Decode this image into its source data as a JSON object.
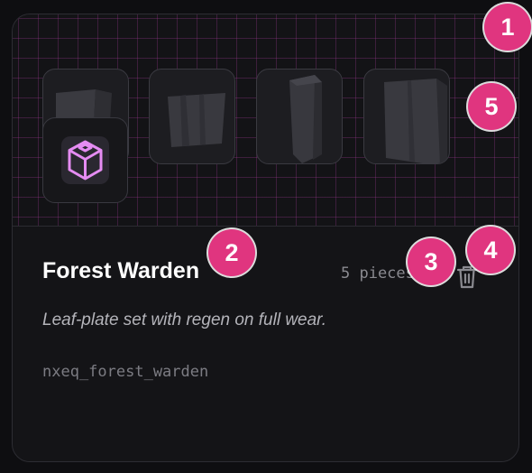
{
  "card": {
    "title": "Forest Warden",
    "pieces": "5 pieces",
    "description": "Leaf-plate set with regen on full wear.",
    "slug": "nxeq_forest_warden"
  },
  "preview": {
    "thumbnails": [
      {
        "icon": "armor-piece-icon"
      },
      {
        "icon": "armor-piece-icon"
      },
      {
        "icon": "armor-piece-icon"
      },
      {
        "icon": "armor-piece-icon"
      }
    ],
    "set_icon": "cube-icon",
    "grid_color": "#aa3ca0"
  },
  "actions": {
    "delete_icon": "trash-icon"
  },
  "markers": [
    "1",
    "2",
    "3",
    "4",
    "5"
  ],
  "colors": {
    "background": "#0e0e11",
    "card": "#141417",
    "accent_purple": "#e58cf2",
    "marker_pink": "#e0357f"
  }
}
